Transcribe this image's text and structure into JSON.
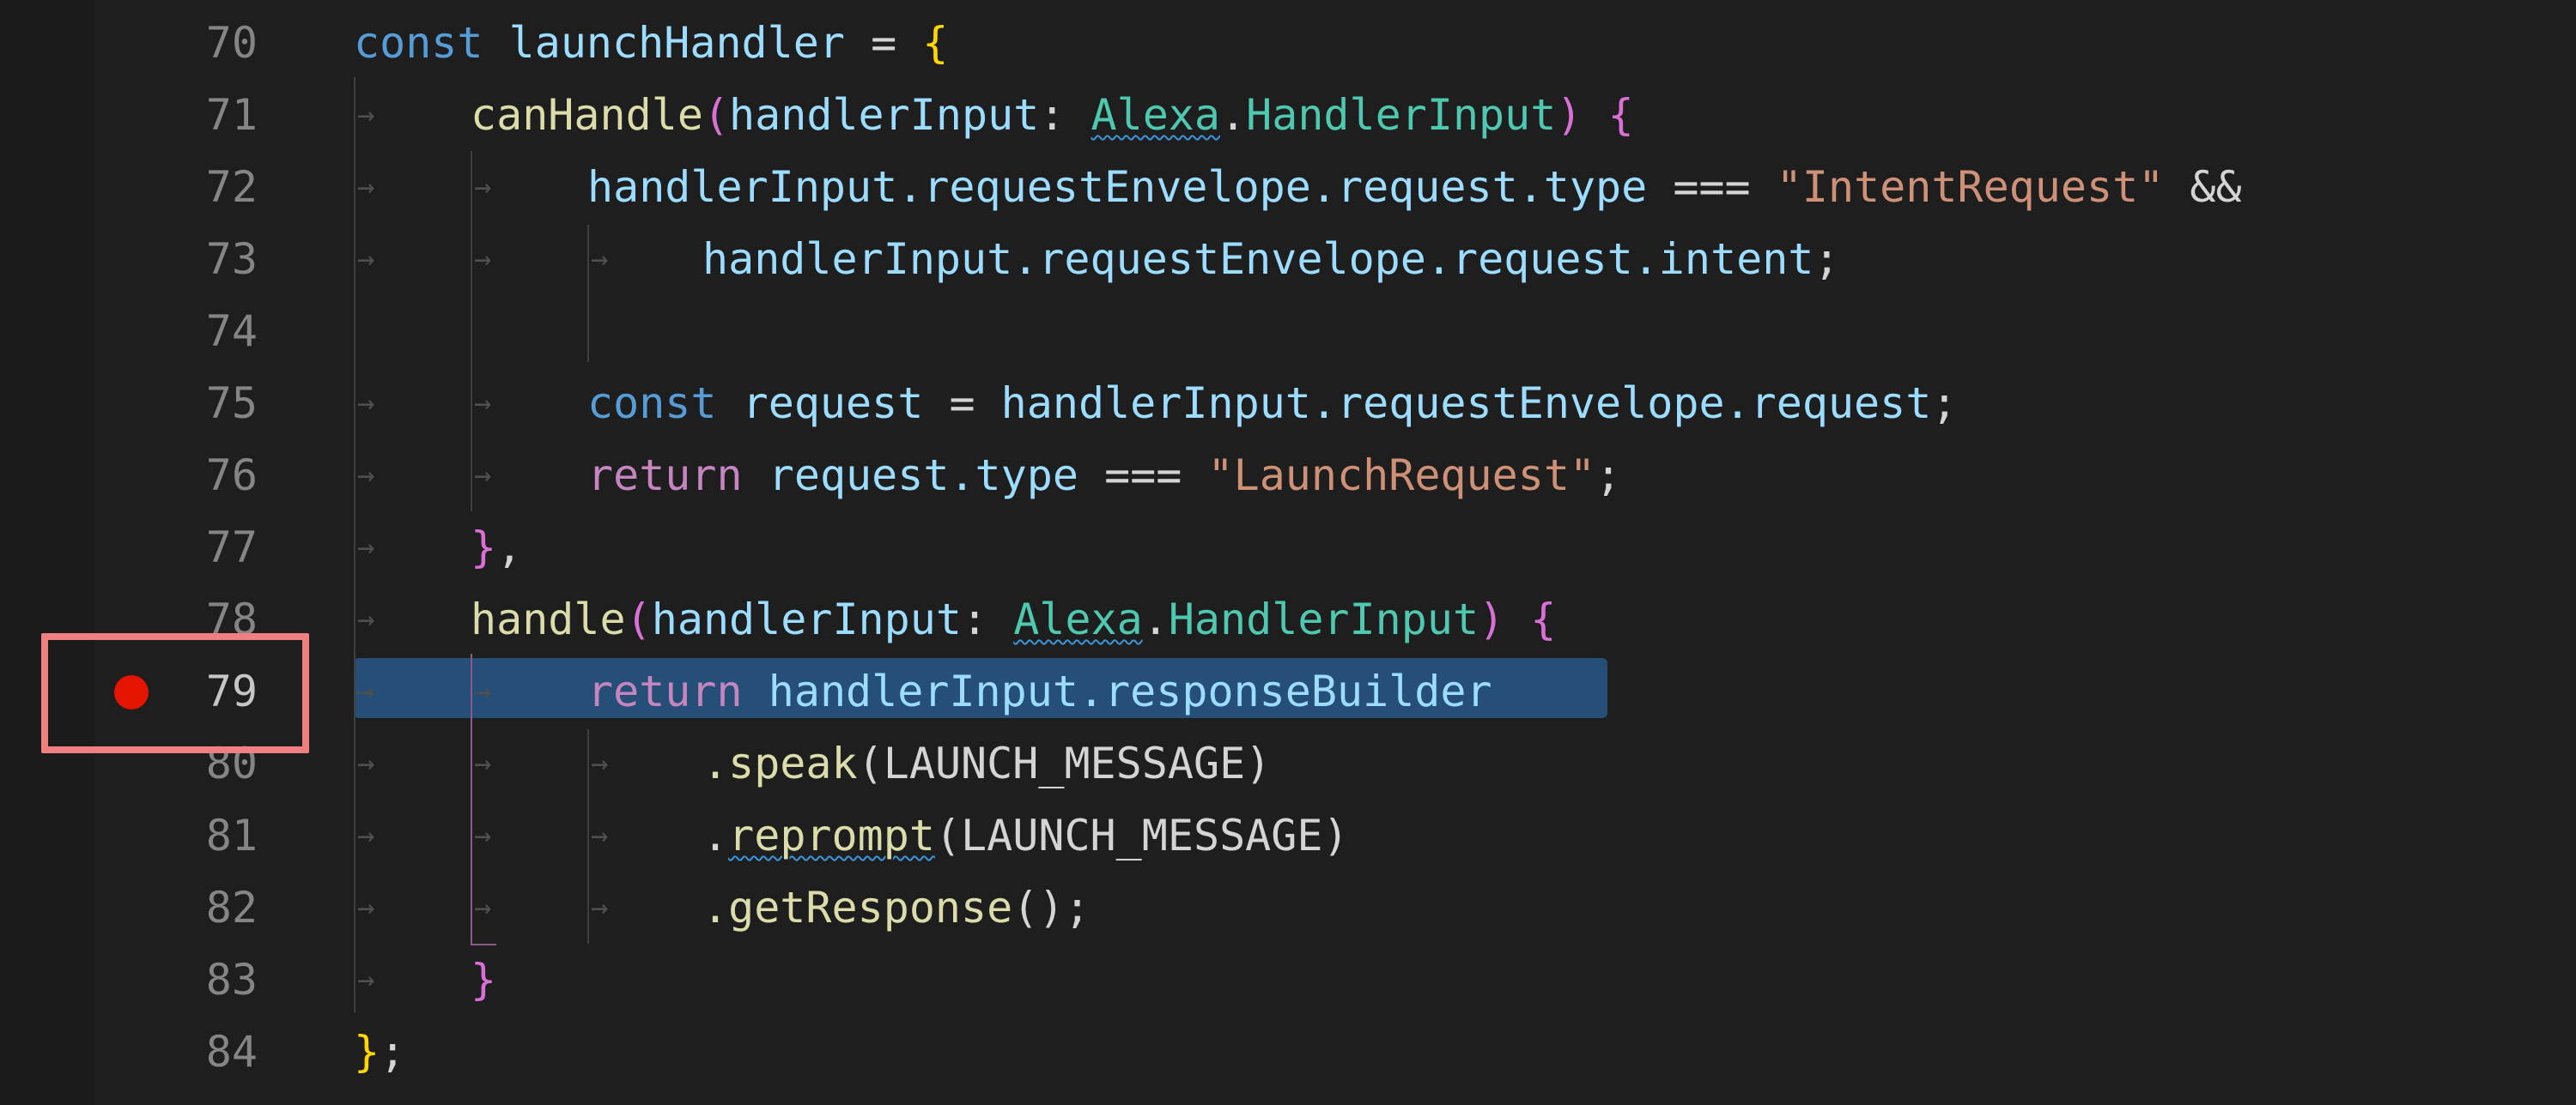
{
  "editor": {
    "colors": {
      "background": "#1e1e1e",
      "keyword": "#569cd6",
      "control": "#c586c0",
      "variable": "#9cdcfe",
      "function": "#dcdcaa",
      "type": "#4ec9b0",
      "string": "#ce9178",
      "selection": "#264f78",
      "breakpoint": "#e51400",
      "highlight_box": "#f08080"
    },
    "breakpoint_line": "79",
    "lines": [
      {
        "num": "70",
        "t": [
          "const",
          "launchHandler",
          "=",
          "{"
        ]
      },
      {
        "num": "71",
        "t": [
          "canHandle",
          "(",
          "handlerInput",
          ":",
          "Alexa",
          ".",
          "HandlerInput",
          ")",
          "{"
        ]
      },
      {
        "num": "72",
        "t": [
          "handlerInput.requestEnvelope.request.type",
          "===",
          "\"IntentRequest\"",
          "&&"
        ]
      },
      {
        "num": "73",
        "t": [
          "handlerInput.requestEnvelope.request.intent",
          ";"
        ]
      },
      {
        "num": "74",
        "t": []
      },
      {
        "num": "75",
        "t": [
          "const",
          "request",
          "=",
          "handlerInput.requestEnvelope.request",
          ";"
        ]
      },
      {
        "num": "76",
        "t": [
          "return",
          "request.type",
          "===",
          "\"LaunchRequest\"",
          ";"
        ]
      },
      {
        "num": "77",
        "t": [
          "}",
          ","
        ]
      },
      {
        "num": "78",
        "t": [
          "handle",
          "(",
          "handlerInput",
          ":",
          "Alexa",
          ".",
          "HandlerInput",
          ")",
          "{"
        ]
      },
      {
        "num": "79",
        "t": [
          "return",
          "handlerInput.responseBuilder"
        ]
      },
      {
        "num": "80",
        "t": [
          ".speak",
          "(",
          "LAUNCH_MESSAGE",
          ")"
        ]
      },
      {
        "num": "81",
        "t": [
          ".",
          "reprompt",
          "(",
          "LAUNCH_MESSAGE",
          ")"
        ]
      },
      {
        "num": "82",
        "t": [
          ".getResponse",
          "()",
          ";"
        ]
      },
      {
        "num": "83",
        "t": [
          "}"
        ]
      },
      {
        "num": "84",
        "t": [
          "}",
          ";"
        ]
      }
    ]
  }
}
